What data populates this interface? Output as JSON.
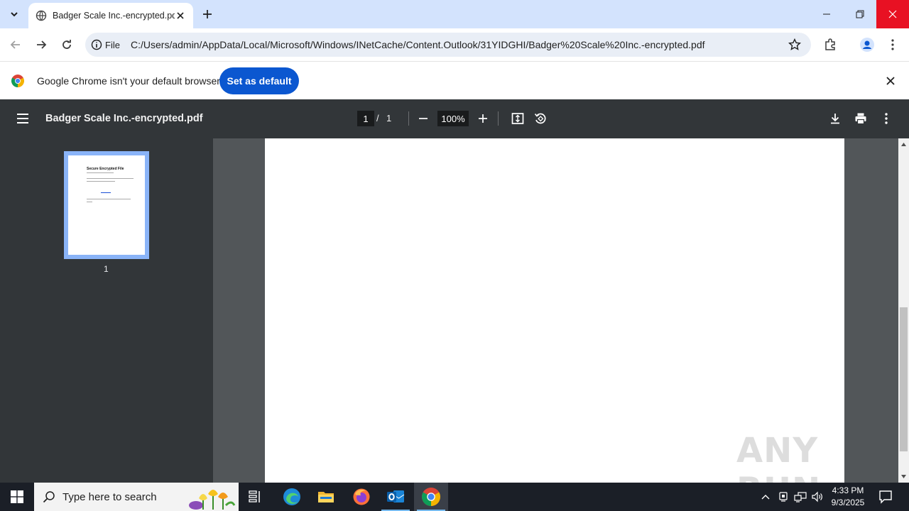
{
  "browser": {
    "tab": {
      "title": "Badger Scale Inc.-encrypted.pdf"
    },
    "omnibox": {
      "scheme_label": "File",
      "url": "C:/Users/admin/AppData/Local/Microsoft/Windows/INetCache/Content.Outlook/31YIDGHI/Badger%20Scale%20Inc.-encrypted.pdf"
    },
    "infobar": {
      "message": "Google Chrome isn't your default browser",
      "button_label": "Set as default"
    }
  },
  "pdf_viewer": {
    "title": "Badger Scale Inc.-encrypted.pdf",
    "current_page": "1",
    "separator": "/",
    "total_pages": "1",
    "zoom": "100%",
    "thumbnail": {
      "page_number": "1",
      "heading": "Secure Encrypted File"
    }
  },
  "watermark": "ANY RUN",
  "taskbar": {
    "search_placeholder": "Type here to search",
    "time": "4:33 PM",
    "date": "9/3/2025"
  },
  "colors": {
    "tabstrip": "#d3e3fd",
    "accent_button": "#0b57d0",
    "pdf_toolbar": "#323639",
    "pdf_background": "#525659",
    "taskbar": "#1b1f27",
    "window_close": "#e81123"
  }
}
